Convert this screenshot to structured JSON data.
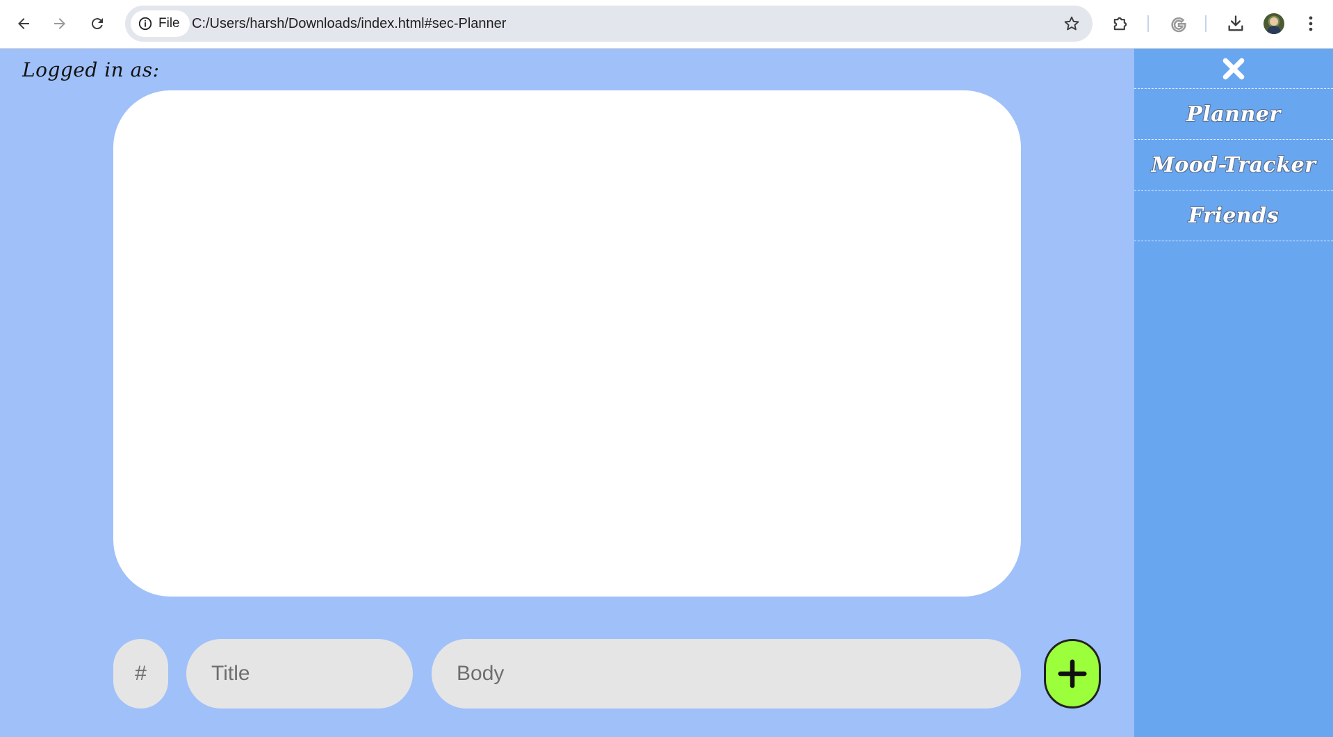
{
  "browser": {
    "site_chip_label": "File",
    "url": "C:/Users/harsh/Downloads/index.html#sec-Planner"
  },
  "page": {
    "logged_in_label": "Logged in as:"
  },
  "form": {
    "hash_placeholder": "#",
    "title_placeholder": "Title",
    "body_placeholder": "Body",
    "add_icon": "plus-icon"
  },
  "side_menu": {
    "close_icon": "close-x-icon",
    "items": [
      {
        "label": "Planner"
      },
      {
        "label": "Mood-Tracker"
      },
      {
        "label": "Friends"
      }
    ]
  },
  "colors": {
    "page_bg": "#a0c0f9",
    "side_menu_bg": "#68a6f0",
    "board_bg": "#ffffff",
    "input_bg": "#e5e5e5",
    "add_button": "#9bff3b"
  }
}
